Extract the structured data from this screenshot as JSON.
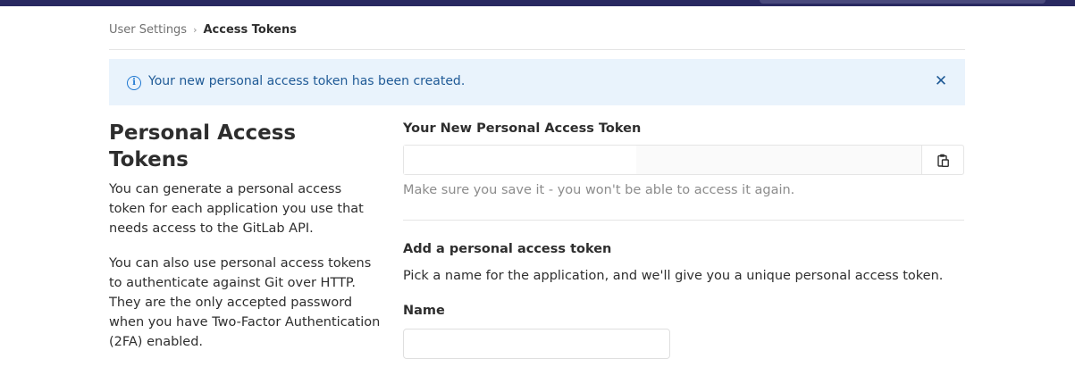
{
  "breadcrumb": {
    "parent": "User Settings",
    "separator": "›",
    "current": "Access Tokens"
  },
  "flash": {
    "message": "Your new personal access token has been created.",
    "info_icon": "info-icon",
    "close_icon": "close-icon",
    "color": "#1f78d1",
    "background": "#e9f3fc"
  },
  "left": {
    "title": "Personal Access Tokens",
    "paragraph1": "You can generate a personal access token for each application you use that needs access to the GitLab API.",
    "paragraph2": "You can also use personal access tokens to authenticate against Git over HTTP. They are the only accepted password when you have Two-Factor Authentication (2FA) enabled."
  },
  "new_token": {
    "label": "Your New Personal Access Token",
    "value": "",
    "copy_icon": "clipboard-icon",
    "help": "Make sure you save it - you won't be able to access it again."
  },
  "add_token": {
    "title": "Add a personal access token",
    "description": "Pick a name for the application, and we'll give you a unique personal access token.",
    "name_label": "Name",
    "name_value": ""
  },
  "colors": {
    "topbar": "#292961"
  }
}
